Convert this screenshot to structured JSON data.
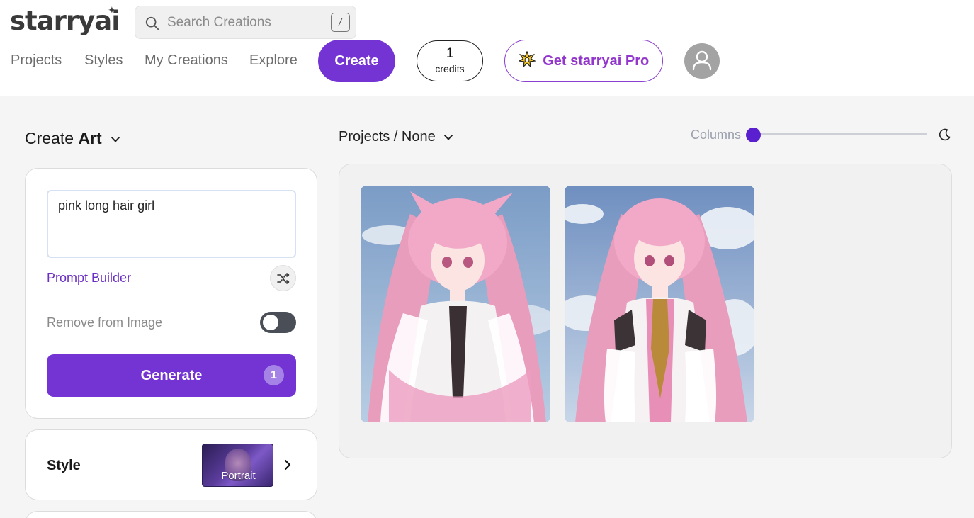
{
  "header": {
    "logo": "starryai",
    "search": {
      "placeholder": "Search Creations",
      "shortcut": "/"
    },
    "nav": [
      "Projects",
      "Styles",
      "My Creations",
      "Explore"
    ],
    "create_label": "Create",
    "credits": {
      "count": "1",
      "label": "credits"
    },
    "pro_label": "Get starryai Pro",
    "icons": {
      "search": "search-icon",
      "pro": "sparkle-badge-icon",
      "avatar": "user-avatar-icon"
    }
  },
  "left": {
    "title_prefix": "Create",
    "title_bold": "Art",
    "prompt_value": "pink long hair girl",
    "prompt_builder_label": "Prompt Builder",
    "remove_label": "Remove from Image",
    "remove_enabled": false,
    "generate_label": "Generate",
    "generate_badge": "1",
    "style_label": "Style",
    "style_value": "Portrait"
  },
  "right": {
    "breadcrumb": "Projects / None",
    "columns_label": "Columns",
    "columns_value": 1,
    "images": [
      {
        "alt": "Anime girl with long pink hair in white dress against blue sky"
      },
      {
        "alt": "Anime girl with long pink hair in white and gold outfit against cloudy sky"
      }
    ]
  },
  "colors": {
    "accent": "#7434d4",
    "pro": "#9236cc",
    "link": "#6c2fc4",
    "slider_knob": "#5a1fcf"
  }
}
